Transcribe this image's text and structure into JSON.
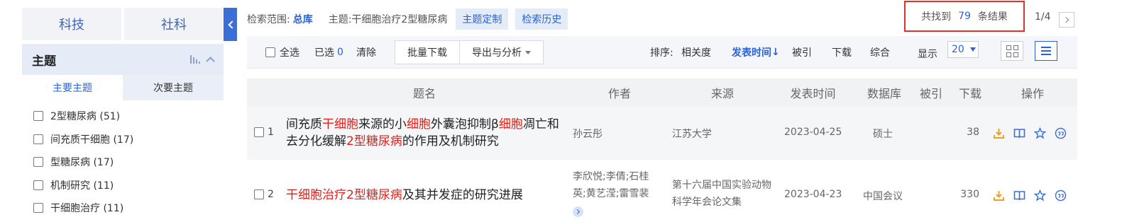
{
  "left_panel": {
    "category_tabs": [
      "科技",
      "社科"
    ],
    "facet": {
      "title": "主题",
      "sub_tabs": [
        "主要主题",
        "次要主题"
      ],
      "items": [
        "2型糖尿病 (51)",
        "间充质干细胞 (17)",
        "型糖尿病 (17)",
        "机制研究 (11)",
        "干细胞治疗 (11)"
      ]
    }
  },
  "search_info": {
    "scope_label": "检索范围:",
    "scope_value": "总库",
    "topic": "主题:干细胞治疗2型糖尿病",
    "custom_topic_label": "主题定制",
    "history_label": "检索历史",
    "result_prefix": "共找到",
    "result_count": "79",
    "result_suffix": "条结果",
    "page_indicator": "1/4"
  },
  "toolbar": {
    "select_all": "全选",
    "selected_label": "已选",
    "selected_count": "0",
    "clear": "清除",
    "batch_download": "批量下载",
    "export_analyze": "导出与分析",
    "sort_label": "排序:",
    "sort_options": [
      "相关度",
      "发表时间",
      "被引",
      "下载",
      "综合"
    ],
    "sort_active_arrow": "↓",
    "display_label": "显示",
    "page_size": "20"
  },
  "table": {
    "headers": [
      "题名",
      "作者",
      "来源",
      "发表时间",
      "数据库",
      "被引",
      "下载",
      "操作"
    ],
    "rows": [
      {
        "index": "1",
        "title_parts": [
          {
            "text": "间充质",
            "hl": false
          },
          {
            "text": "干细胞",
            "hl": true
          },
          {
            "text": "来源的小",
            "hl": false
          },
          {
            "text": "细胞",
            "hl": true
          },
          {
            "text": "外囊泡抑制β",
            "hl": false
          },
          {
            "text": "细胞",
            "hl": true
          },
          {
            "text": "凋亡和去分化缓解",
            "hl": false
          },
          {
            "text": "2型糖尿病",
            "hl": true
          },
          {
            "text": "的作用及机制研究",
            "hl": false
          }
        ],
        "author": "孙云彤",
        "source": "江苏大学",
        "date": "2023-04-25",
        "database": "硕士",
        "cited": "",
        "downloads": "38"
      },
      {
        "index": "2",
        "title_parts": [
          {
            "text": "干细胞治疗2型糖尿病",
            "hl": true
          },
          {
            "text": "及其并发症的研究进展",
            "hl": false
          }
        ],
        "author": "李欣悦;李倩;石桂英;黄艺滢;雷雪裴",
        "source": "第十六届中国实验动物科学年会论文集",
        "date": "2023-04-23",
        "database": "中国会议",
        "cited": "",
        "downloads": "330"
      }
    ]
  },
  "colors": {
    "accent": "#2a62d6",
    "highlight": "#e0211c",
    "op_download": "#f0a022",
    "result_box_border": "#e5302c"
  }
}
